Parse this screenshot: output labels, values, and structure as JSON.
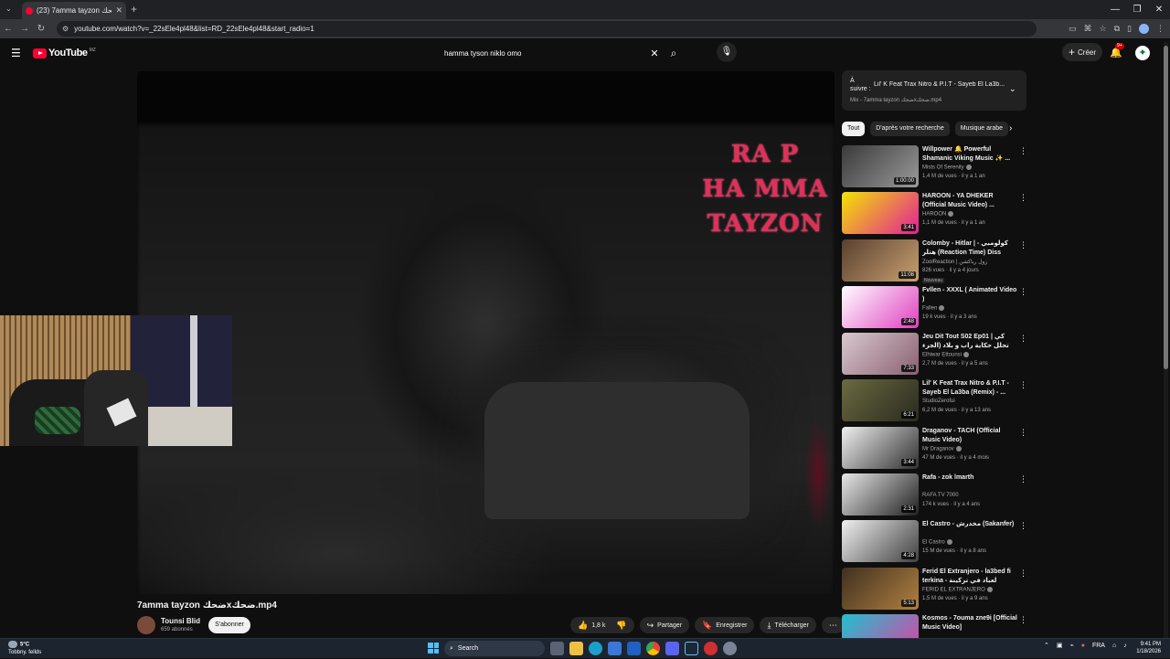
{
  "browser": {
    "tab_title": "(23) 7amma tayzon ضحكx...",
    "url": "youtube.com/watch?v=_22sEle4pl48&list=RD_22sEle4pl48&start_radio=1",
    "new_tab_label": "+",
    "window_controls": [
      "—",
      "❐",
      "✕"
    ]
  },
  "youtube": {
    "logo_text": "YouTube",
    "country_code": "MZ",
    "search_value": "hamma tyson niklo omo",
    "create_label": "Créer",
    "notifications_count": "9+"
  },
  "player": {
    "overlay_lines": [
      "RA P",
      "HA MMA",
      "TAYZON"
    ]
  },
  "video": {
    "title": "7amma tayzon ضحكxضحك.mp4",
    "channel": "Tounsi Blid",
    "subscribers": "659 abonnés",
    "subscribe_label": "S'abonner",
    "likes": "1,8 k",
    "share_label": "Partager",
    "save_label": "Enregistrer",
    "download_label": "Télécharger"
  },
  "queue": {
    "label_line1": "À",
    "label_line2": "suivre :",
    "next_title": "Lil' K Feat Trax Nitro & P.I.T - Sayeb El La3b...",
    "mix_label": "Mix - 7amma tayzon ضحكxضحك.mp4"
  },
  "chips": [
    "Tout",
    "D'après votre recherche",
    "Musique arabe"
  ],
  "recommendations": [
    {
      "title": "Willpower 🔔 Powerful Shamanic Viking Music ✨ ...",
      "channel": "Mists Of Serenity",
      "meta": "1,4 M de vues · il y a 1 an",
      "duration": "1:00:00",
      "verified": true,
      "badge": "",
      "thumb_colors": [
        "#3a3a3a",
        "#9a9a9a"
      ]
    },
    {
      "title": "HAROON - YA DHEKER (Official Music Video) ...",
      "channel": "HAROON",
      "meta": "1,1 M de vues · il y a 1 an",
      "duration": "3:41",
      "verified": true,
      "badge": "",
      "thumb_colors": [
        "#f4e400",
        "#e0209a"
      ]
    },
    {
      "title": "Colomby - Hitlar | كولومبي - هتلر (Reaction Time) Diss Track ...",
      "channel": "ZoolReaction | زول رياكشن",
      "meta": "826 vues · il y a 4 jours",
      "duration": "11:08",
      "verified": false,
      "badge": "Nouveau",
      "thumb_colors": [
        "#5a4030",
        "#c8a070"
      ]
    },
    {
      "title": "Fvllen - XXXL ( Animated Video )",
      "channel": "Fallen",
      "meta": "19 k vues · il y a 3 ans",
      "duration": "2:48",
      "verified": true,
      "badge": "",
      "thumb_colors": [
        "#ffffff",
        "#e040c0"
      ]
    },
    {
      "title": "Jeu Dit Tout S02 Ep01 | كي تحلل حكاية راب و بلاد (الجزء الثاني)",
      "channel": "Elhiwar Ettounsi",
      "meta": "2,7 M de vues · il y a 5 ans",
      "duration": "7:33",
      "verified": true,
      "badge": "",
      "thumb_colors": [
        "#d8c8d0",
        "#8a6070"
      ]
    },
    {
      "title": "Lil' K Feat Trax Nitro & P.I.T - Sayeb El La3ba (Remix) - ...",
      "channel": "StudioZerofui",
      "meta": "6,2 M de vues · il y a 13 ans",
      "duration": "6:21",
      "verified": false,
      "badge": "",
      "thumb_colors": [
        "#6a6a40",
        "#2a2a20"
      ]
    },
    {
      "title": "Draganov - TACH (Official Music Video)",
      "channel": "Mr Draganov",
      "meta": "47 M de vues · il y a 4 mois",
      "duration": "3:44",
      "verified": true,
      "badge": "",
      "thumb_colors": [
        "#f0f0f0",
        "#303030"
      ]
    },
    {
      "title": "Rafa - zok lmarth",
      "channel": "RAFA TV 7000",
      "meta": "174 k vues · il y a 4 ans",
      "duration": "2:31",
      "verified": false,
      "badge": "",
      "thumb_colors": [
        "#e8e8e8",
        "#202020"
      ]
    },
    {
      "title": "El Castro - مخدرش (Sakanfer)",
      "channel": "El Castro",
      "meta": "15 M de vues · il y a 8 ans",
      "duration": "4:28",
      "verified": true,
      "badge": "",
      "thumb_colors": [
        "#f0f0f0",
        "#404040"
      ]
    },
    {
      "title": "Ferid El Extranjero - la3bed fi terkina - لعباد في تركينة",
      "channel": "FERID EL EXTRANJERO",
      "meta": "1,5 M de vues · il y a 9 ans",
      "duration": "5:13",
      "verified": true,
      "badge": "",
      "thumb_colors": [
        "#403020",
        "#b08040"
      ]
    },
    {
      "title": "Kosmos - 7ouma zne9i [Official Music Video]",
      "channel": "",
      "meta": "",
      "duration": "",
      "verified": false,
      "badge": "",
      "thumb_colors": [
        "#20c0d0",
        "#e040a0"
      ]
    }
  ],
  "taskbar": {
    "temperature": "5°C",
    "weather_desc": "Tobbny. fellds",
    "search_label": "Search",
    "lang": "FRA",
    "time": "9:41 PM",
    "date": "1/18/2026"
  },
  "colors": {
    "accent": "#ff0033",
    "overlay_text": "#e0305a"
  }
}
